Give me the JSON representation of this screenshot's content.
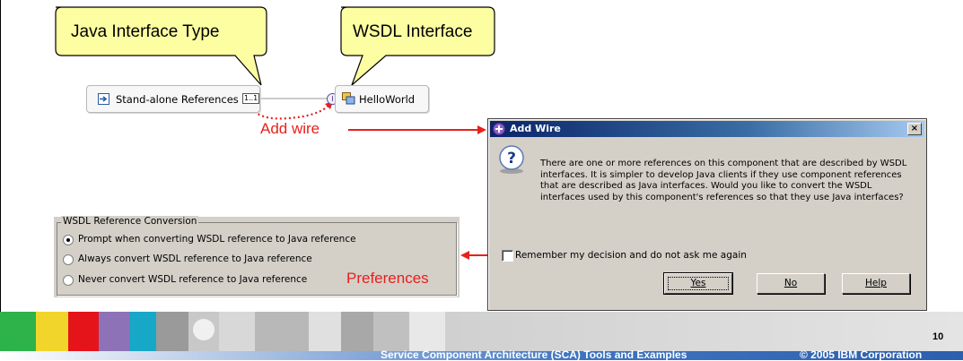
{
  "callouts": {
    "java_interface_type": "Java Interface Type",
    "wsdl_interface": "WSDL Interface"
  },
  "canvas": {
    "standalone_references": "Stand-alone References",
    "multiplicity": "1..1",
    "interface_marker": "I",
    "component_name": "HelloWorld"
  },
  "annotations": {
    "add_wire": "Add wire",
    "preferences": "Preferences",
    "accent_color": "#e8201c"
  },
  "dialog": {
    "title": "Add Wire",
    "close": "×",
    "message": "There are one or more references on this component that are described by WSDL interfaces. It is simpler to develop Java clients if they use component references that are described as Java interfaces. Would you like to convert the WSDL interfaces used by this component's references so that they use Java interfaces?",
    "checkbox_label": "Remember my decision and do not ask me again",
    "checkbox_checked": false,
    "buttons": {
      "yes": "Yes",
      "no": "No",
      "help": "Help"
    }
  },
  "preferences_group": {
    "legend": "WSDL Reference Conversion",
    "options": [
      {
        "label": "Prompt when converting WSDL reference to Java reference",
        "selected": true
      },
      {
        "label": "Always convert WSDL reference to Java reference",
        "selected": false
      },
      {
        "label": "Never convert WSDL reference to Java reference",
        "selected": false
      }
    ]
  },
  "footer": {
    "page_number": "10",
    "title": "Service Component Architecture (SCA) Tools and Examples",
    "copyright": "© 2005 IBM Corporation"
  }
}
